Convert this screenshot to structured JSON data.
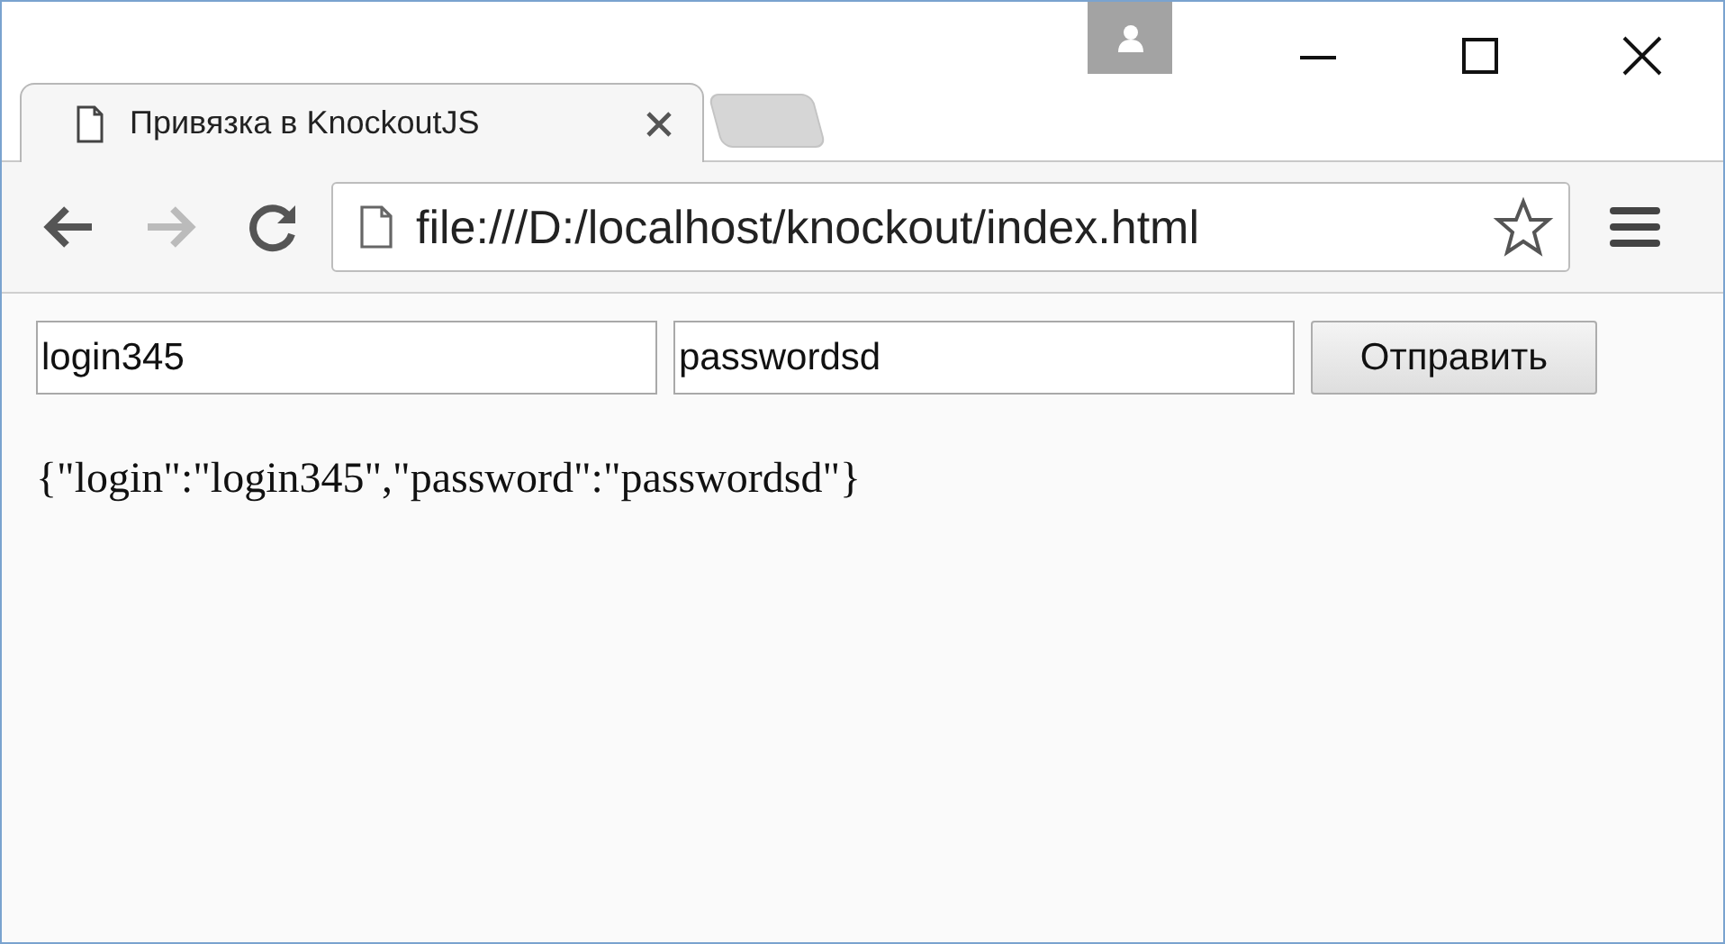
{
  "tabs": [
    {
      "title": "Привязка в KnockoutJS",
      "selected": true
    }
  ],
  "address_bar": {
    "url": "file:///D:/localhost/knockout/index.html"
  },
  "form": {
    "login": {
      "value": "login345"
    },
    "password": {
      "value": "passwordsd"
    },
    "submit": {
      "label": "Отправить"
    }
  },
  "output": {
    "text": "{\"login\":\"login345\",\"password\":\"passwordsd\"}"
  }
}
